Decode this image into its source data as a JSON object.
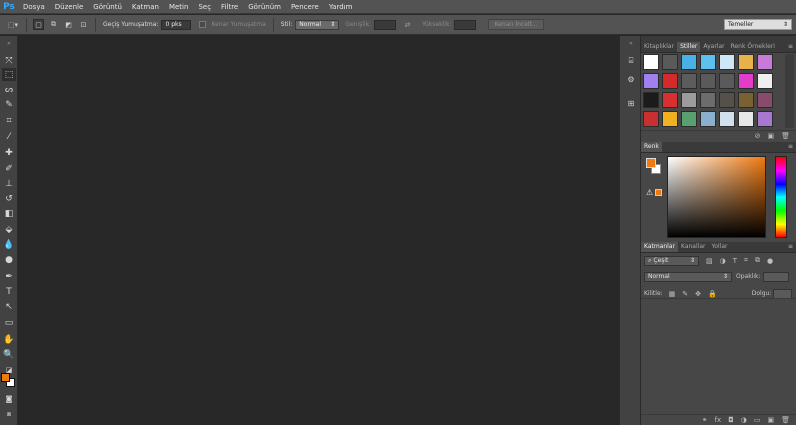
{
  "app": {
    "logo": "Ps",
    "accent_color": "#31a8ff"
  },
  "menu": [
    "Dosya",
    "Düzenle",
    "Görüntü",
    "Katman",
    "Metin",
    "Seç",
    "Filtre",
    "Görünüm",
    "Pencere",
    "Yardım"
  ],
  "options": {
    "feather_label": "Geçiş Yumuşatma:",
    "feather_value": "0 pks",
    "antialias_label": "Kenar Yumuşatma",
    "style_label": "Stil:",
    "style_value": "Normal",
    "width_label": "Genişlik:",
    "height_label": "Yükseklik:",
    "refine_edge_button": "Kenarı İncelt...",
    "workspace_value": "Temeller"
  },
  "colors": {
    "foreground": "#f07a10",
    "background": "#ffffff"
  },
  "styles_panel": {
    "tabs": [
      "Kitaplıklar",
      "Stiller",
      "Ayarlar",
      "Renk Örnekleri"
    ],
    "active_tab": "Stiller",
    "swatches": [
      "#ffffff",
      "#5a5a5a",
      "#4ab0e8",
      "#5cc0f0",
      "#cfe6f4",
      "#e8b24a",
      "#c87ad8",
      "#a080f0",
      "#d42a2a",
      "#5c5c5c",
      "#5a5a5a",
      "#5a5a5a",
      "#e23cc8",
      "#efefef",
      "#1b1b1b",
      "#d83030",
      "#9c9c9c",
      "#6c6c6c",
      "#55514a",
      "#7a6230",
      "#8a4a6a",
      "#c83030",
      "#f0b020",
      "#58a070",
      "#8ab0d0",
      "#d0e0ec",
      "#e8e8e8",
      "#a878d0"
    ]
  },
  "color_panel": {
    "title": "Renk"
  },
  "layers_panel": {
    "tabs": [
      "Katmanlar",
      "Kanallar",
      "Yollar"
    ],
    "active_tab": "Katmanlar",
    "filter_placeholder": "Çeşit",
    "blend_mode": "Normal",
    "opacity_label": "Opaklık:",
    "lock_label": "Kilitle:",
    "fill_label": "Dolgu:"
  }
}
